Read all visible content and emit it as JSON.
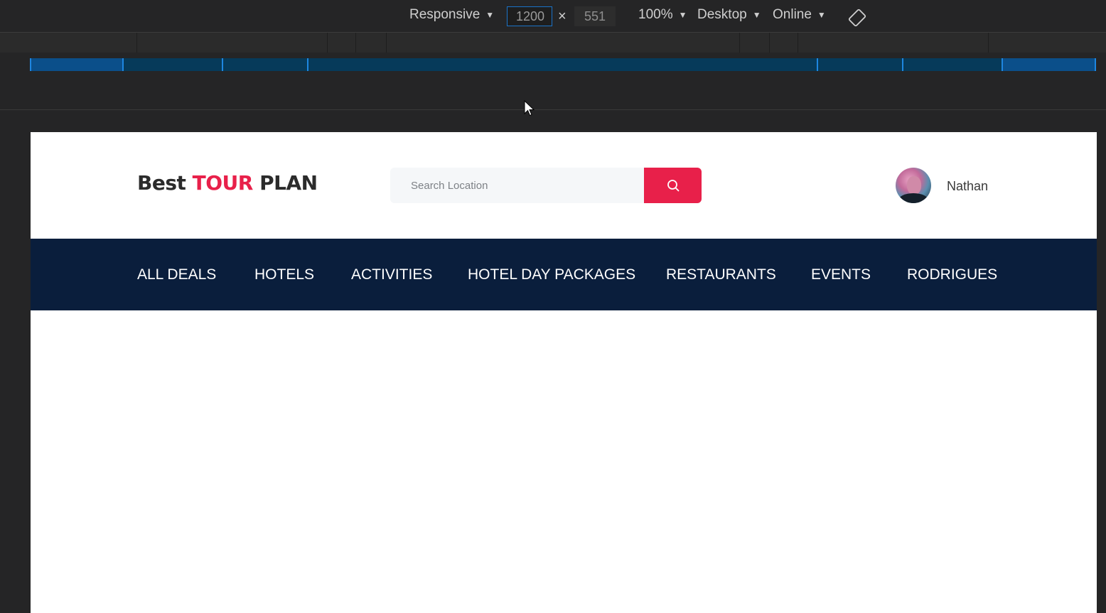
{
  "devtools": {
    "device": "Responsive",
    "width_value": "1200",
    "times": "×",
    "height_value": "551",
    "zoom": "100%",
    "device_type": "Desktop",
    "throttling": "Online",
    "rotate_icon": "rotate-icon"
  },
  "site": {
    "logo": {
      "word1": "Best",
      "word2": "TOUR",
      "word3": "PLAN"
    },
    "search": {
      "placeholder": "Search Location",
      "icon": "search-icon"
    },
    "user": {
      "name": "Nathan"
    },
    "nav": [
      "ALL DEALS",
      "HOTELS",
      "ACTIVITIES",
      "HOTEL DAY PACKAGES",
      "RESTAURANTS",
      "EVENTS",
      "RODRIGUES"
    ]
  },
  "colors": {
    "accent": "#e8204a",
    "nav_bg": "#0a1e3c",
    "devtools_bg": "#252526",
    "ruler_blue": "#1e86e0"
  }
}
